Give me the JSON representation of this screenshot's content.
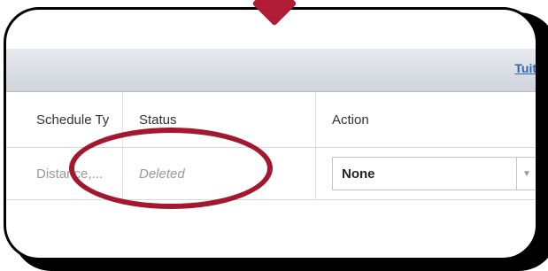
{
  "header": {
    "link_label": "Tuition"
  },
  "table": {
    "columns": [
      "Schedule Ty",
      "Status",
      "Action"
    ],
    "rows": [
      {
        "schedule_type": "Distance,...",
        "status": "Deleted",
        "action": "None"
      }
    ]
  },
  "colors": {
    "annotation": "#a3182e",
    "link": "#2b63b3",
    "header_band": "#d8dce1"
  },
  "icons": [
    "dropdown-arrow-icon"
  ]
}
